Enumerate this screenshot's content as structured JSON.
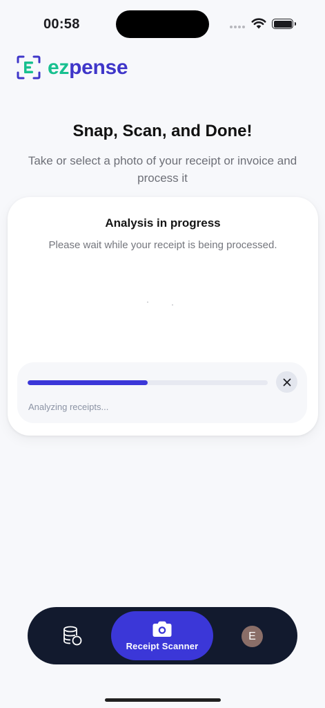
{
  "status_bar": {
    "time": "00:58"
  },
  "brand": {
    "ez": "ez",
    "pense": "pense",
    "colors": {
      "green": "#18c08f",
      "indigo": "#3f36c9"
    }
  },
  "header": {
    "title": "Snap, Scan, and Done!",
    "subtitle": "Take or select a photo of your receipt or invoice and process it"
  },
  "analysis": {
    "title": "Analysis in progress",
    "description": "Please wait while your receipt is being processed.",
    "progress_fraction": 0.5,
    "status": "Analyzing receipts..."
  },
  "nav": {
    "items": [
      {
        "icon": "database-icon"
      },
      {
        "icon": "camera-icon",
        "label": "Receipt Scanner",
        "active": true
      },
      {
        "icon": "avatar",
        "initial": "E"
      }
    ],
    "accent": "#3b37d8"
  }
}
